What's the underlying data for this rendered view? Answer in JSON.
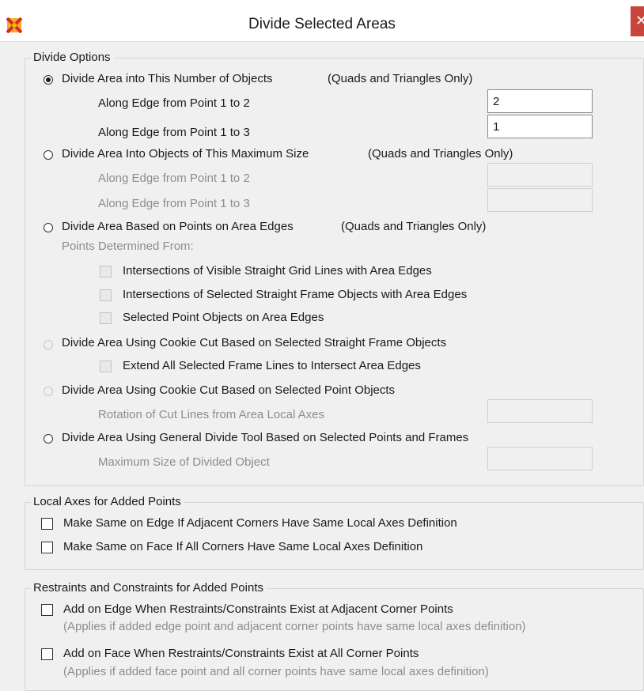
{
  "window": {
    "title": "Divide Selected Areas",
    "close_label": "✕"
  },
  "divide_options": {
    "legend": "Divide Options",
    "option_number": {
      "label": "Divide Area into This Number of Objects",
      "note": "(Quads and Triangles Only)",
      "selected": true,
      "edge12_label": "Along Edge from Point 1 to 2",
      "edge12_value": "2",
      "edge13_label": "Along Edge from Point 1 to 3",
      "edge13_value": "1"
    },
    "option_max_size": {
      "label": "Divide Area Into Objects of This Maximum Size",
      "note": "(Quads and Triangles Only)",
      "edge12_label": "Along Edge from Point 1 to 2",
      "edge13_label": "Along Edge from Point 1 to 3"
    },
    "option_points_on_edges": {
      "label": "Divide Area Based on Points on Area Edges",
      "note": "(Quads and Triangles Only)",
      "points_from_label": "Points Determined From:",
      "checks": [
        "Intersections of Visible Straight Grid Lines with Area Edges",
        "Intersections of Selected Straight Frame Objects with Area Edges",
        "Selected Point Objects on Area Edges"
      ]
    },
    "option_cookie_frames": {
      "label": "Divide Area Using Cookie Cut Based on Selected Straight Frame Objects",
      "extend_label": "Extend All Selected Frame Lines to Intersect Area Edges"
    },
    "option_cookie_points": {
      "label": "Divide Area Using Cookie Cut Based on Selected Point Objects",
      "rotation_label": "Rotation of Cut Lines from Area Local Axes"
    },
    "option_general": {
      "label": "Divide Area Using General Divide Tool Based on Selected Points and Frames",
      "max_size_label": "Maximum Size of Divided Object"
    }
  },
  "local_axes": {
    "legend": "Local Axes for Added Points",
    "items": [
      "Make Same on Edge If Adjacent Corners Have Same Local Axes Definition",
      "Make Same on Face If All Corners Have Same Local Axes Definition"
    ]
  },
  "restraints": {
    "legend": "Restraints and Constraints for Added Points",
    "items": [
      {
        "label": "Add on Edge When Restraints/Constraints Exist at Adjacent Corner Points",
        "note": "(Applies if added edge point and adjacent corner points have same local axes definition)"
      },
      {
        "label": "Add on Face When Restraints/Constraints Exist at All Corner Points",
        "note": "(Applies if added face point and all corner points have same local axes definition)"
      }
    ]
  }
}
